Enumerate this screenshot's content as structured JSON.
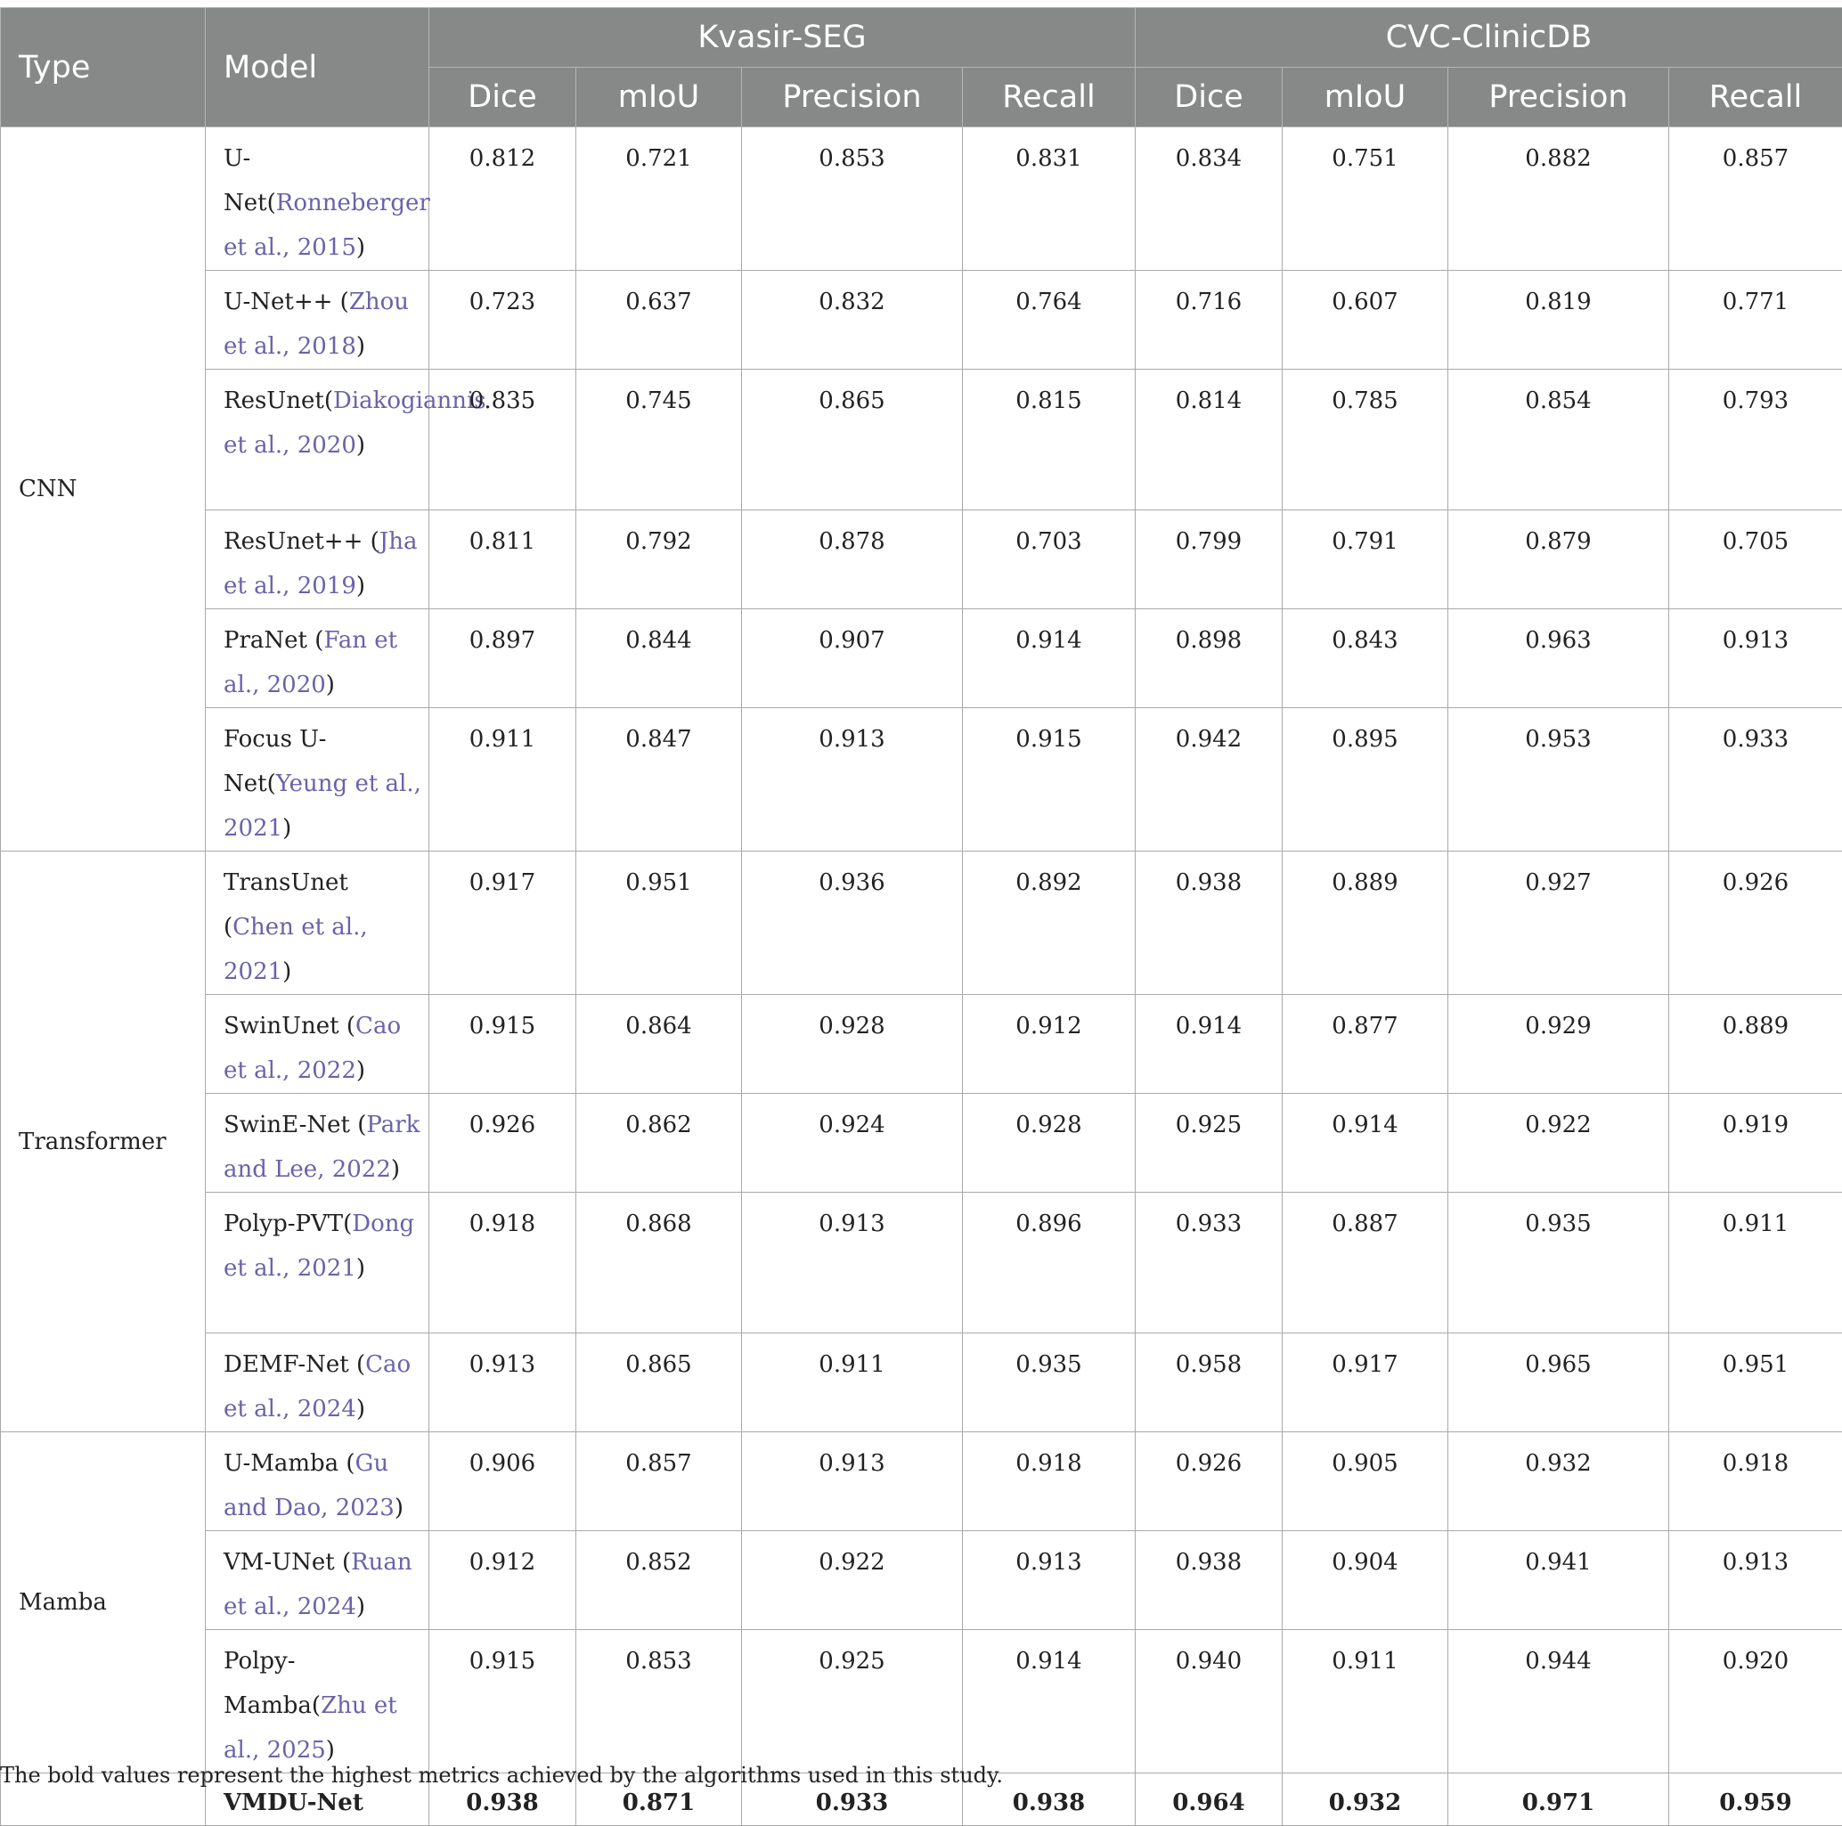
{
  "header": {
    "type": "Type",
    "model": "Model",
    "group1": "Kvasir-SEG",
    "group2": "CVC-ClinicDB",
    "metrics": [
      "Dice",
      "mIoU",
      "Precision",
      "Recall",
      "Dice",
      "mIoU",
      "Precision",
      "Recall"
    ]
  },
  "types": {
    "cnn": "CNN",
    "transformer": "Transformer",
    "mamba": "Mamba"
  },
  "rows": [
    {
      "name": "U-Net",
      "pre": "(",
      "cite": "Ronneberger et al., 2015",
      "post": ")",
      "values": [
        "0.812",
        "0.721",
        "0.853",
        "0.831",
        "0.834",
        "0.751",
        "0.882",
        "0.857"
      ]
    },
    {
      "name": "U-Net++",
      "pre": " (",
      "cite": "Zhou et al., 2018",
      "post": ")",
      "values": [
        "0.723",
        "0.637",
        "0.832",
        "0.764",
        "0.716",
        "0.607",
        "0.819",
        "0.771"
      ]
    },
    {
      "name": "ResUnet",
      "pre": "(",
      "cite": "Diakogiannis et al., 2020",
      "post": ")",
      "values": [
        "0.835",
        "0.745",
        "0.865",
        "0.815",
        "0.814",
        "0.785",
        "0.854",
        "0.793"
      ]
    },
    {
      "name": "ResUnet++",
      "pre": " (",
      "cite": "Jha et al., 2019",
      "post": ")",
      "values": [
        "0.811",
        "0.792",
        "0.878",
        "0.703",
        "0.799",
        "0.791",
        "0.879",
        "0.705"
      ]
    },
    {
      "name": "PraNet",
      "pre": " (",
      "cite": "Fan et al., 2020",
      "post": ")",
      "values": [
        "0.897",
        "0.844",
        "0.907",
        "0.914",
        "0.898",
        "0.843",
        "0.963",
        "0.913"
      ]
    },
    {
      "name": "Focus U-Net",
      "pre": "(",
      "cite": "Yeung et al., 2021",
      "post": ")",
      "values": [
        "0.911",
        "0.847",
        "0.913",
        "0.915",
        "0.942",
        "0.895",
        "0.953",
        "0.933"
      ]
    },
    {
      "name": "TransUnet",
      "pre": " (",
      "cite": "Chen et al., 2021",
      "post": ")",
      "values": [
        "0.917",
        "0.951",
        "0.936",
        "0.892",
        "0.938",
        "0.889",
        "0.927",
        "0.926"
      ]
    },
    {
      "name": "SwinUnet",
      "pre": " (",
      "cite": "Cao et al., 2022",
      "post": ")",
      "values": [
        "0.915",
        "0.864",
        "0.928",
        "0.912",
        "0.914",
        "0.877",
        "0.929",
        "0.889"
      ]
    },
    {
      "name": "SwinE-Net",
      "pre": " (",
      "cite": "Park and Lee, 2022",
      "post": ")",
      "values": [
        "0.926",
        "0.862",
        "0.924",
        "0.928",
        "0.925",
        "0.914",
        "0.922",
        "0.919"
      ]
    },
    {
      "name": "Polyp-PVT",
      "pre": "(",
      "cite": "Dong et al., 2021",
      "post": ")",
      "values": [
        "0.918",
        "0.868",
        "0.913",
        "0.896",
        "0.933",
        "0.887",
        "0.935",
        "0.911"
      ]
    },
    {
      "name": "DEMF-Net",
      "pre": " (",
      "cite": "Cao et al., 2024",
      "post": ")",
      "values": [
        "0.913",
        "0.865",
        "0.911",
        "0.935",
        "0.958",
        "0.917",
        "0.965",
        "0.951"
      ]
    },
    {
      "name": "U-Mamba",
      "pre": " (",
      "cite": "Gu and Dao, 2023",
      "post": ")",
      "values": [
        "0.906",
        "0.857",
        "0.913",
        "0.918",
        "0.926",
        "0.905",
        "0.932",
        "0.918"
      ]
    },
    {
      "name": "VM-UNet",
      "pre": " (",
      "cite": "Ruan et al., 2024",
      "post": ")",
      "values": [
        "0.912",
        "0.852",
        "0.922",
        "0.913",
        "0.938",
        "0.904",
        "0.941",
        "0.913"
      ]
    },
    {
      "name": "Polpy-Mamba",
      "pre": "(",
      "cite": "Zhu et al., 2025",
      "post": ")",
      "values": [
        "0.915",
        "0.853",
        "0.925",
        "0.914",
        "0.940",
        "0.911",
        "0.944",
        "0.920"
      ]
    }
  ],
  "final": {
    "name": "VMDU-Net",
    "values": [
      "0.938",
      "0.871",
      "0.933",
      "0.938",
      "0.964",
      "0.932",
      "0.971",
      "0.959"
    ]
  },
  "caption": "The bold values represent the highest metrics achieved by the algorithms used in this study.",
  "colors": {
    "header_bg": "#878888",
    "citation": "#6a62ab"
  }
}
